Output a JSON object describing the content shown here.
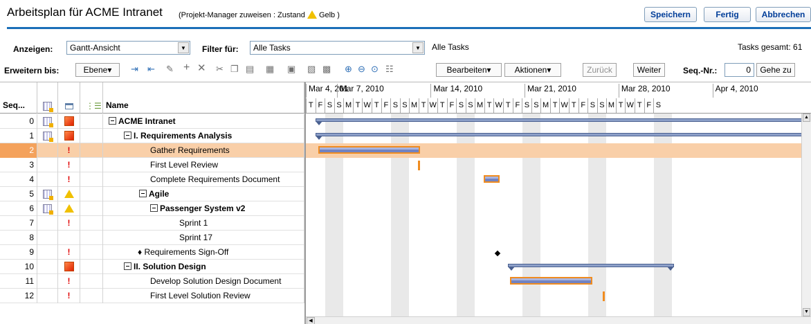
{
  "header": {
    "title": "Arbeitsplan für ACME Intranet",
    "subtitle_prefix": "(Projekt-Manager zuweisen : Zustand",
    "subtitle_status": "Gelb )",
    "status_color": "#f0c000",
    "buttons": {
      "save": "Speichern",
      "done": "Fertig",
      "cancel": "Abbrechen"
    }
  },
  "filters": {
    "view_label": "Anzeigen:",
    "view_value": "Gantt-Ansicht",
    "filter_label": "Filter für:",
    "filter_value": "Alle Tasks",
    "filter_summary": "Alle Tasks",
    "total_label": "Tasks gesamt: 61"
  },
  "toolbar": {
    "expand_label": "Erweitern bis:",
    "level_label": "Ebene▾",
    "edit_label": "Bearbeiten▾",
    "actions_label": "Aktionen▾",
    "back_label": "Zurück",
    "next_label": "Weiter",
    "seq_label": "Seq.-Nr.:",
    "seq_value": "0",
    "goto_label": "Gehe zu"
  },
  "grid": {
    "columns": {
      "seq": "Seq...",
      "name": "Name"
    },
    "rows": [
      {
        "seq": "0",
        "name": "ACME Intranet",
        "col1": "calendar",
        "col2": "red",
        "level": 0,
        "bold": true,
        "expand": true
      },
      {
        "seq": "1",
        "name": "I. Requirements Analysis",
        "col1": "calendar",
        "col2": "red",
        "level": 1,
        "bold": true,
        "expand": true
      },
      {
        "seq": "2",
        "name": "Gather Requirements",
        "col1": "",
        "col2": "excl",
        "level": 3,
        "bold": false,
        "selected": true
      },
      {
        "seq": "3",
        "name": "First Level Review",
        "col1": "",
        "col2": "excl",
        "level": 3,
        "bold": false
      },
      {
        "seq": "4",
        "name": "Complete Requirements Document",
        "col1": "",
        "col2": "excl",
        "level": 3,
        "bold": false
      },
      {
        "seq": "5",
        "name": "Agile",
        "col1": "calendar",
        "col2": "yellow",
        "level": 2,
        "bold": true,
        "expand": true
      },
      {
        "seq": "6",
        "name": "Passenger System v2",
        "col1": "calendar",
        "col2": "yellow",
        "level": 3,
        "bold": true,
        "expand": true
      },
      {
        "seq": "7",
        "name": "Sprint 1",
        "col1": "",
        "col2": "excl",
        "level": 4,
        "bold": false
      },
      {
        "seq": "8",
        "name": "Sprint 17",
        "col1": "",
        "col2": "",
        "level": 4,
        "bold": false
      },
      {
        "seq": "9",
        "name": "Requirements Sign-Off",
        "col1": "",
        "col2": "excl",
        "level": 2,
        "bold": false,
        "milestone": true
      },
      {
        "seq": "10",
        "name": "II. Solution Design",
        "col1": "",
        "col2": "red",
        "level": 1,
        "bold": true,
        "expand": true
      },
      {
        "seq": "11",
        "name": "Develop Solution Design Document",
        "col1": "",
        "col2": "excl",
        "level": 3,
        "bold": false
      },
      {
        "seq": "12",
        "name": "First Level Solution Review",
        "col1": "",
        "col2": "excl",
        "level": 3,
        "bold": false
      }
    ]
  },
  "gantt": {
    "weeks": [
      "Mar 4, 201",
      "Mar 7, 2010",
      "Mar 14, 2010",
      "Mar 21, 2010",
      "Mar 28, 2010",
      "Apr 4, 2010"
    ],
    "days": [
      "T",
      "F",
      "S",
      "S",
      "M",
      "T",
      "W",
      "T",
      "F",
      "S",
      "S",
      "M",
      "T",
      "W",
      "T",
      "F",
      "S",
      "S",
      "M",
      "T",
      "W",
      "T",
      "F",
      "S",
      "S",
      "M",
      "T",
      "W",
      "T",
      "F",
      "S",
      "S",
      "M",
      "T",
      "W",
      "T",
      "F",
      "S"
    ]
  }
}
